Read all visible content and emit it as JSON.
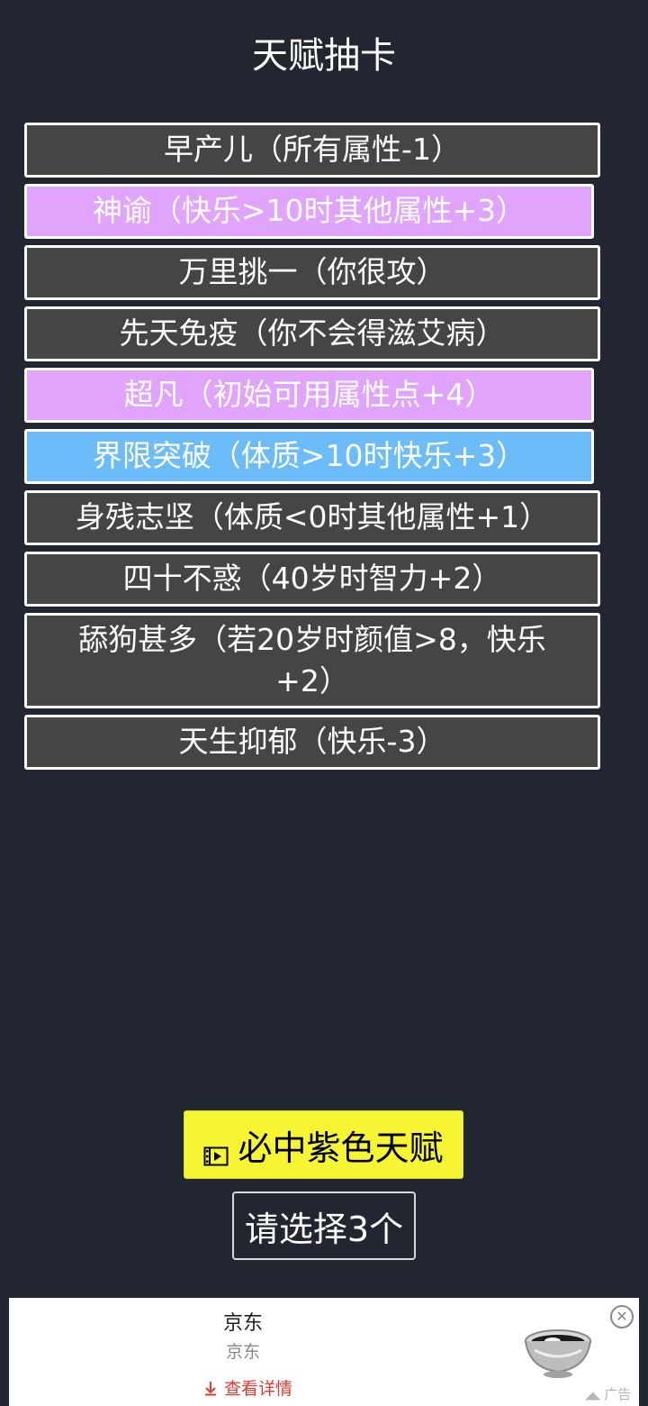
{
  "page": {
    "title": "天赋抽卡"
  },
  "talents": [
    {
      "label": "早产儿（所有属性-1）",
      "grade": "normal",
      "color": "#454545"
    },
    {
      "label": "神谕（快乐>10时其他属性+3）",
      "grade": "purple",
      "color": "#e1a4fc"
    },
    {
      "label": "万里挑一（你很攻）",
      "grade": "normal",
      "color": "#454545"
    },
    {
      "label": "先天免疫（你不会得滋艾病）",
      "grade": "normal",
      "color": "#454545"
    },
    {
      "label": "超凡（初始可用属性点+4）",
      "grade": "purple",
      "color": "#e1a4fc"
    },
    {
      "label": "界限突破（体质>10时快乐+3）",
      "grade": "blue",
      "color": "#6cbcfa"
    },
    {
      "label": "身残志坚（体质<0时其他属性+1）",
      "grade": "normal",
      "color": "#454545"
    },
    {
      "label": "四十不惑（40岁时智力+2）",
      "grade": "normal",
      "color": "#454545"
    },
    {
      "label": "舔狗甚多（若20岁时颜值>8，快乐+2）",
      "grade": "normal",
      "color": "#454545"
    },
    {
      "label": "天生抑郁（快乐-3）",
      "grade": "normal",
      "color": "#454545"
    }
  ],
  "actions": {
    "guarantee_label": "必中紫色天赋",
    "guarantee_icon": "video-film-icon",
    "select_label": "请选择3个"
  },
  "ad": {
    "title": "京东",
    "subtitle": "京东",
    "link_label": "查看详情",
    "link_icon": "download-arrow-icon",
    "mark": "广告",
    "image": "steel-bowl-image"
  },
  "colors": {
    "background": "#222631",
    "guarantee_button": "#f5f533",
    "ad_link": "#e33b2e"
  }
}
